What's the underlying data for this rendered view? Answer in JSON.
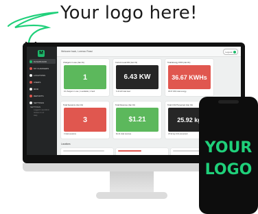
{
  "headline": "Your logo here!",
  "colors": {
    "green": "#5cb85c",
    "red": "#e0574f",
    "dark": "#262626",
    "brand": "#1db96b"
  },
  "app": {
    "logo_letter": "M",
    "welcome": "Welcome back, Lorenzo Rossi",
    "logout_label": "Log out"
  },
  "sidebar": {
    "items": [
      {
        "label": "Dashboard",
        "icon": "dashboard-icon"
      },
      {
        "label": "My Chargers",
        "icon": "charger-icon"
      },
      {
        "label": "Locations",
        "icon": "pin-icon"
      },
      {
        "label": "Users",
        "icon": "user-icon"
      },
      {
        "label": "RFID",
        "icon": "card-icon"
      },
      {
        "label": "Reports",
        "icon": "report-icon"
      },
      {
        "label": "Settings",
        "icon": "gear-icon"
      }
    ],
    "settings_header": "Settings",
    "settings_lines": [
      "Logged in as Admin",
      "Version 2.1.0",
      "Help"
    ]
  },
  "cards": [
    {
      "title": "Chargers in use   (Jan 01)",
      "value": "1",
      "footer": "16 chargers in use | 1 available | 1 fault",
      "color": "#5cb85c"
    },
    {
      "title": "Current Load kW   (Jan 01)",
      "value": "6.43 KW",
      "footer": "6.43 kW total load",
      "color": "#262626"
    },
    {
      "title": "Total Energy KWh   (Jan 01)",
      "value": "36.67 KWHs",
      "footer": "36.67 kWh total energy",
      "color": "#e0574f"
    },
    {
      "title": "Total Sessions   (Jan 01)",
      "value": "3",
      "footer": "3 total sessions",
      "color": "#e0574f"
    },
    {
      "title": "Total Revenue   (Jan 01)",
      "value": "$1.21",
      "footer": "$1.21 total revenue",
      "color": "#5cb85c"
    },
    {
      "title": "Total CO2 Prevented   (Jan 01)",
      "value": "25.92 kg",
      "footer": "25.92 kg CO2 prevented",
      "color": "#262626"
    }
  ],
  "bottom": {
    "section_label": "Locations"
  },
  "phone": {
    "line1": "YOUR",
    "line2": "LOGO"
  }
}
